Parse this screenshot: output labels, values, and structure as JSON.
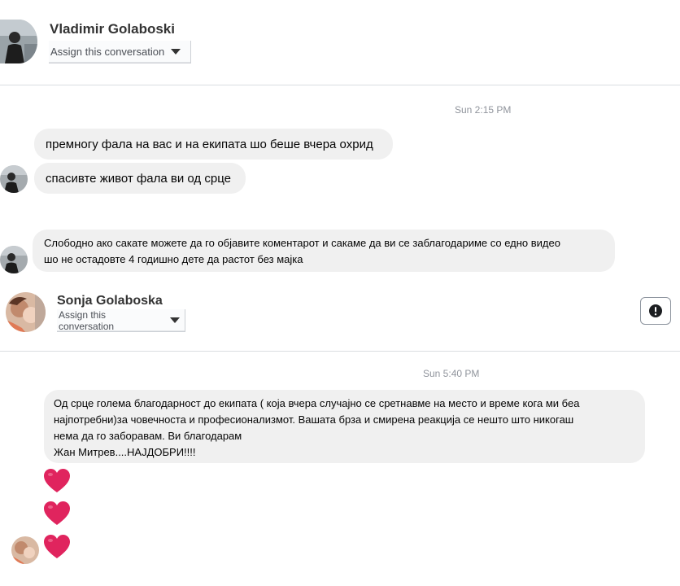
{
  "conversation_1": {
    "contact_name": "Vladimir Golaboski",
    "assign_label": "Assign this conversation",
    "timestamp": "Sun 2:15 PM",
    "messages": [
      "премногу фала на вас и на екипата шо беше вчера охрид",
      "спасивте живот фала ви од срце",
      "Слободно ако сакате можете да го објавите коментарот и сакаме да ви се заблагодариме со едно видео",
      "шо не остадовте 4 годишно дете да растот без мајка"
    ]
  },
  "conversation_2": {
    "contact_name": "Sonja Golaboska",
    "assign_label": "Assign this conversation",
    "report_icon": "exclamation-circle-icon",
    "timestamp": "Sun 5:40 PM",
    "message_lines": [
      "Од срце голема благодарност до екипата ( која вчера случајно се сретнавме на место и време кога ми беа",
      "најпотребни)за човечноста и професионализмот. Вашата брза и смирена реакција се нешто што никогаш",
      "нема да го заборавам. Ви благодарам",
      "Жан Митрев....НАЈДОБРИ!!!!"
    ],
    "reactions": [
      "heart-emoji",
      "heart-emoji",
      "heart-emoji"
    ]
  },
  "colors": {
    "bubble": "#f0f0f0",
    "heart": "#e0245e",
    "timestamp": "#90949c",
    "divider": "#dadde1"
  }
}
